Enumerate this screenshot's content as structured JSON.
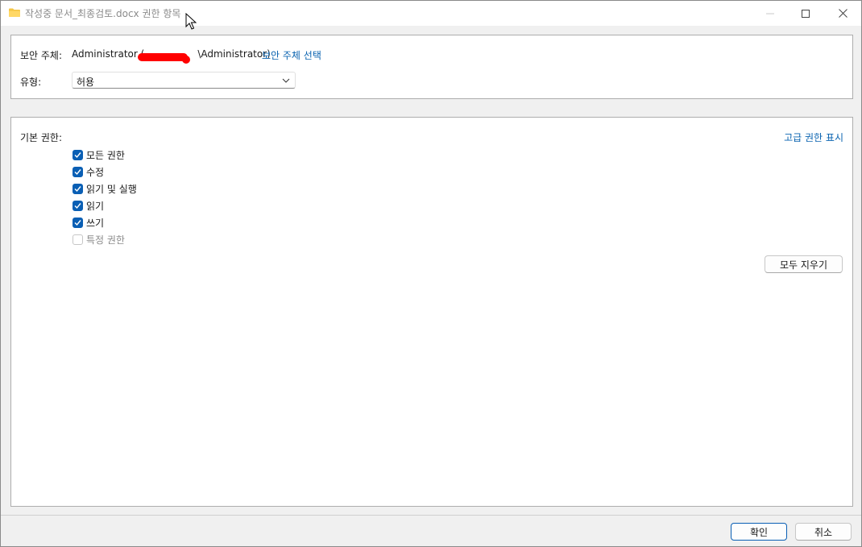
{
  "window": {
    "title": "작성중 문서_최종검토.docx 권한 항목",
    "icon": "folder-icon",
    "controls": [
      "minimize-icon",
      "maximize-icon",
      "close-icon"
    ]
  },
  "principal": {
    "label": "보안 주체:",
    "value_start": "Administrator (",
    "value_end": "\\Administrator)",
    "select_link": "보안 주체 선택"
  },
  "type": {
    "label": "유형:",
    "selected": "허용"
  },
  "basic_permissions": {
    "label": "기본 권한:",
    "advanced_link": "고급 권한 표시",
    "items": [
      {
        "label": "모든 권한",
        "checked": true,
        "enabled": true
      },
      {
        "label": "수정",
        "checked": true,
        "enabled": true
      },
      {
        "label": "읽기 및 실행",
        "checked": true,
        "enabled": true
      },
      {
        "label": "읽기",
        "checked": true,
        "enabled": true
      },
      {
        "label": "쓰기",
        "checked": true,
        "enabled": true
      },
      {
        "label": "특정 권한",
        "checked": false,
        "enabled": false
      }
    ],
    "clear_all": "모두 지우기"
  },
  "footer": {
    "ok": "확인",
    "cancel": "취소"
  },
  "colors": {
    "accent": "#0a5fb4",
    "link": "#0a63b0",
    "redaction": "#ff0000"
  }
}
